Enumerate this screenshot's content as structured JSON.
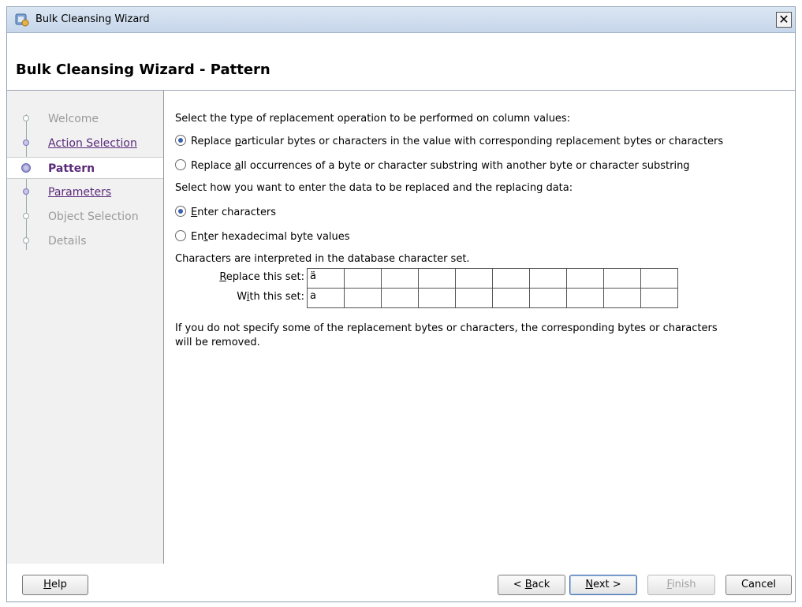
{
  "window": {
    "title": "Bulk Cleansing Wizard",
    "close_label": "✕"
  },
  "header": {
    "page_title": "Bulk Cleansing Wizard - Pattern"
  },
  "sidebar": {
    "steps": [
      {
        "label": "Welcome",
        "state": "disabled"
      },
      {
        "label": "Action Selection",
        "state": "link"
      },
      {
        "label": "Pattern",
        "state": "active"
      },
      {
        "label": "Parameters",
        "state": "link"
      },
      {
        "label": "Object Selection",
        "state": "disabled"
      },
      {
        "label": "Details",
        "state": "disabled"
      }
    ]
  },
  "content": {
    "prompt_operation": "Select the type of replacement operation to be performed on column values:",
    "op_option_1": {
      "pre": "Replace ",
      "ul": "p",
      "post": "articular bytes or characters in the value with corresponding replacement bytes or characters",
      "checked": true
    },
    "op_option_2": {
      "pre": "Replace ",
      "ul": "a",
      "post": "ll occurrences of a byte or character substring with another byte or character substring",
      "checked": false
    },
    "prompt_entry": "Select how you want to enter the data to be replaced and the replacing data:",
    "entry_option_1": {
      "pre": "",
      "ul": "E",
      "post": "nter characters",
      "checked": true
    },
    "entry_option_2": {
      "pre": "En",
      "ul": "t",
      "post": "er hexadecimal byte values",
      "checked": false
    },
    "charset_note": "Characters are interpreted in the database character set.",
    "replace_row": {
      "label_ul": "R",
      "label_rest": "eplace this set:",
      "cells": [
        "ä",
        "",
        "",
        "",
        "",
        "",
        "",
        "",
        "",
        ""
      ]
    },
    "with_row": {
      "label_pre": "W",
      "label_ul": "i",
      "label_rest": "th this set:",
      "cells": [
        "a",
        "",
        "",
        "",
        "",
        "",
        "",
        "",
        "",
        ""
      ]
    },
    "removal_note_1": "If you do not specify some of the replacement bytes or characters, the corresponding bytes or characters",
    "removal_note_2": "will be removed."
  },
  "footer": {
    "help": {
      "ul": "H",
      "rest": "elp"
    },
    "back": {
      "pre": "< ",
      "ul": "B",
      "rest": "ack"
    },
    "next": {
      "ul": "N",
      "rest": "ext >"
    },
    "finish": {
      "ul": "F",
      "rest": "inish"
    },
    "cancel": "Cancel"
  }
}
